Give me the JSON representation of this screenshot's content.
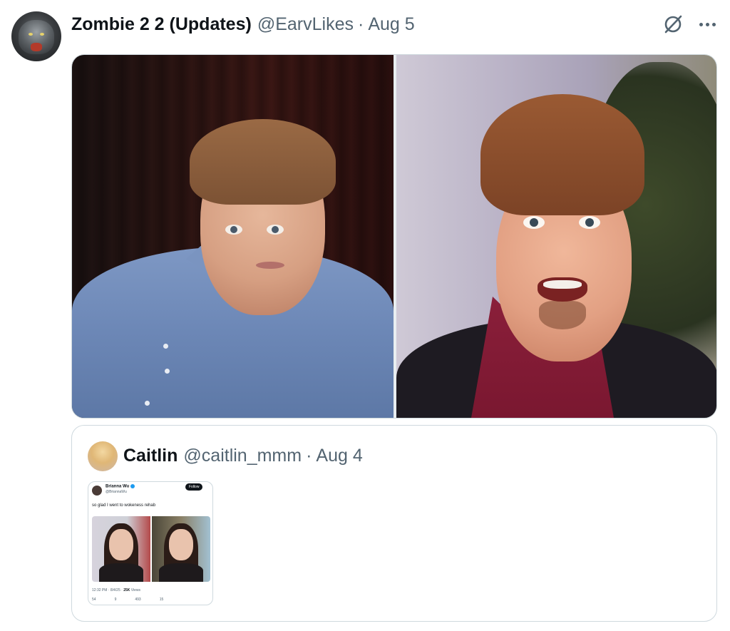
{
  "post": {
    "author_name": "Zombie 2 2 (Updates)",
    "handle": "@EarvLikes",
    "separator": "·",
    "date": "Aug 5",
    "icons": {
      "grok": "grok-icon",
      "more": "more-icon"
    }
  },
  "quote": {
    "author_name": "Caitlin",
    "handle": "@caitlin_mmm",
    "separator": "·",
    "date": "Aug 4",
    "embedded": {
      "name": "Brianna Wu",
      "handle": "@BriannaWu",
      "follow_label": "Follow",
      "text": "so glad I went to wokeness rehab",
      "time": "12:32 PM · 8/4/25 ·",
      "views_count": "25K",
      "views_label": "Views",
      "actions": [
        "54",
        "9",
        "493",
        "15"
      ]
    }
  },
  "colors": {
    "text": "#0f1419",
    "secondary": "#536471",
    "border": "#cfd9de",
    "link": "#1d9bf0"
  }
}
